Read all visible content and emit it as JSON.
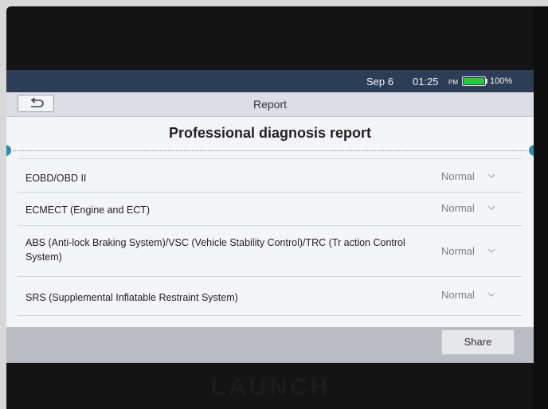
{
  "device": {
    "logo": "LAUNCH"
  },
  "statusbar": {
    "date": "Sep 6",
    "time": "01:25",
    "ampm": "PM",
    "battery": "100%",
    "battery_level": 1.0,
    "battery_color": "#27c93f"
  },
  "titlebar": {
    "title": "Report",
    "back_icon": "back-arrow-icon"
  },
  "report": {
    "title": "Professional diagnosis report",
    "rows": [
      {
        "label": "EOBD/OBD II",
        "status": "Normal"
      },
      {
        "label": "ECMECT (Engine and ECT)",
        "status": "Normal"
      },
      {
        "label": "ABS (Anti-lock Braking System)/VSC (Vehicle Stability Control)/TRC (Tr action Control System)",
        "status": "Normal"
      },
      {
        "label": "SRS (Supplemental Inflatable Restraint System)",
        "status": "Normal"
      }
    ]
  },
  "bottombar": {
    "share_label": "Share"
  },
  "colors": {
    "accent": "#2a8fb0",
    "statusbar_bg": "#2e3d56"
  }
}
